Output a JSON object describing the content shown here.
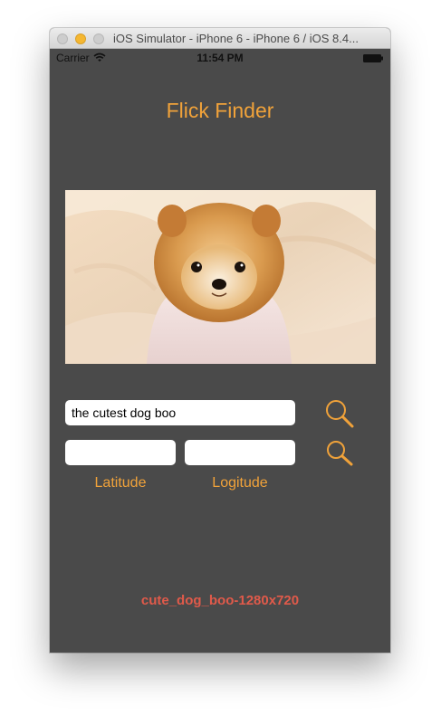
{
  "window": {
    "title": "iOS Simulator - iPhone 6 - iPhone 6 / iOS 8.4..."
  },
  "status_bar": {
    "carrier": "Carrier",
    "time": "11:54 PM"
  },
  "app": {
    "title": "Flick Finder",
    "photo_alt": "cute dog boo",
    "search": {
      "phrase_value": "the cutest dog boo",
      "latitude_value": "",
      "longitude_value": "",
      "latitude_label": "Latitude",
      "longitude_label": "Logitude"
    },
    "photo_title": "cute_dog_boo-1280x720"
  },
  "colors": {
    "background": "#4a4a4a",
    "accent": "#f0a23a",
    "photo_title": "#e05a4a"
  },
  "icons": {
    "phrase_search": "magnifier-icon",
    "latlon_search": "magnifier-icon"
  }
}
